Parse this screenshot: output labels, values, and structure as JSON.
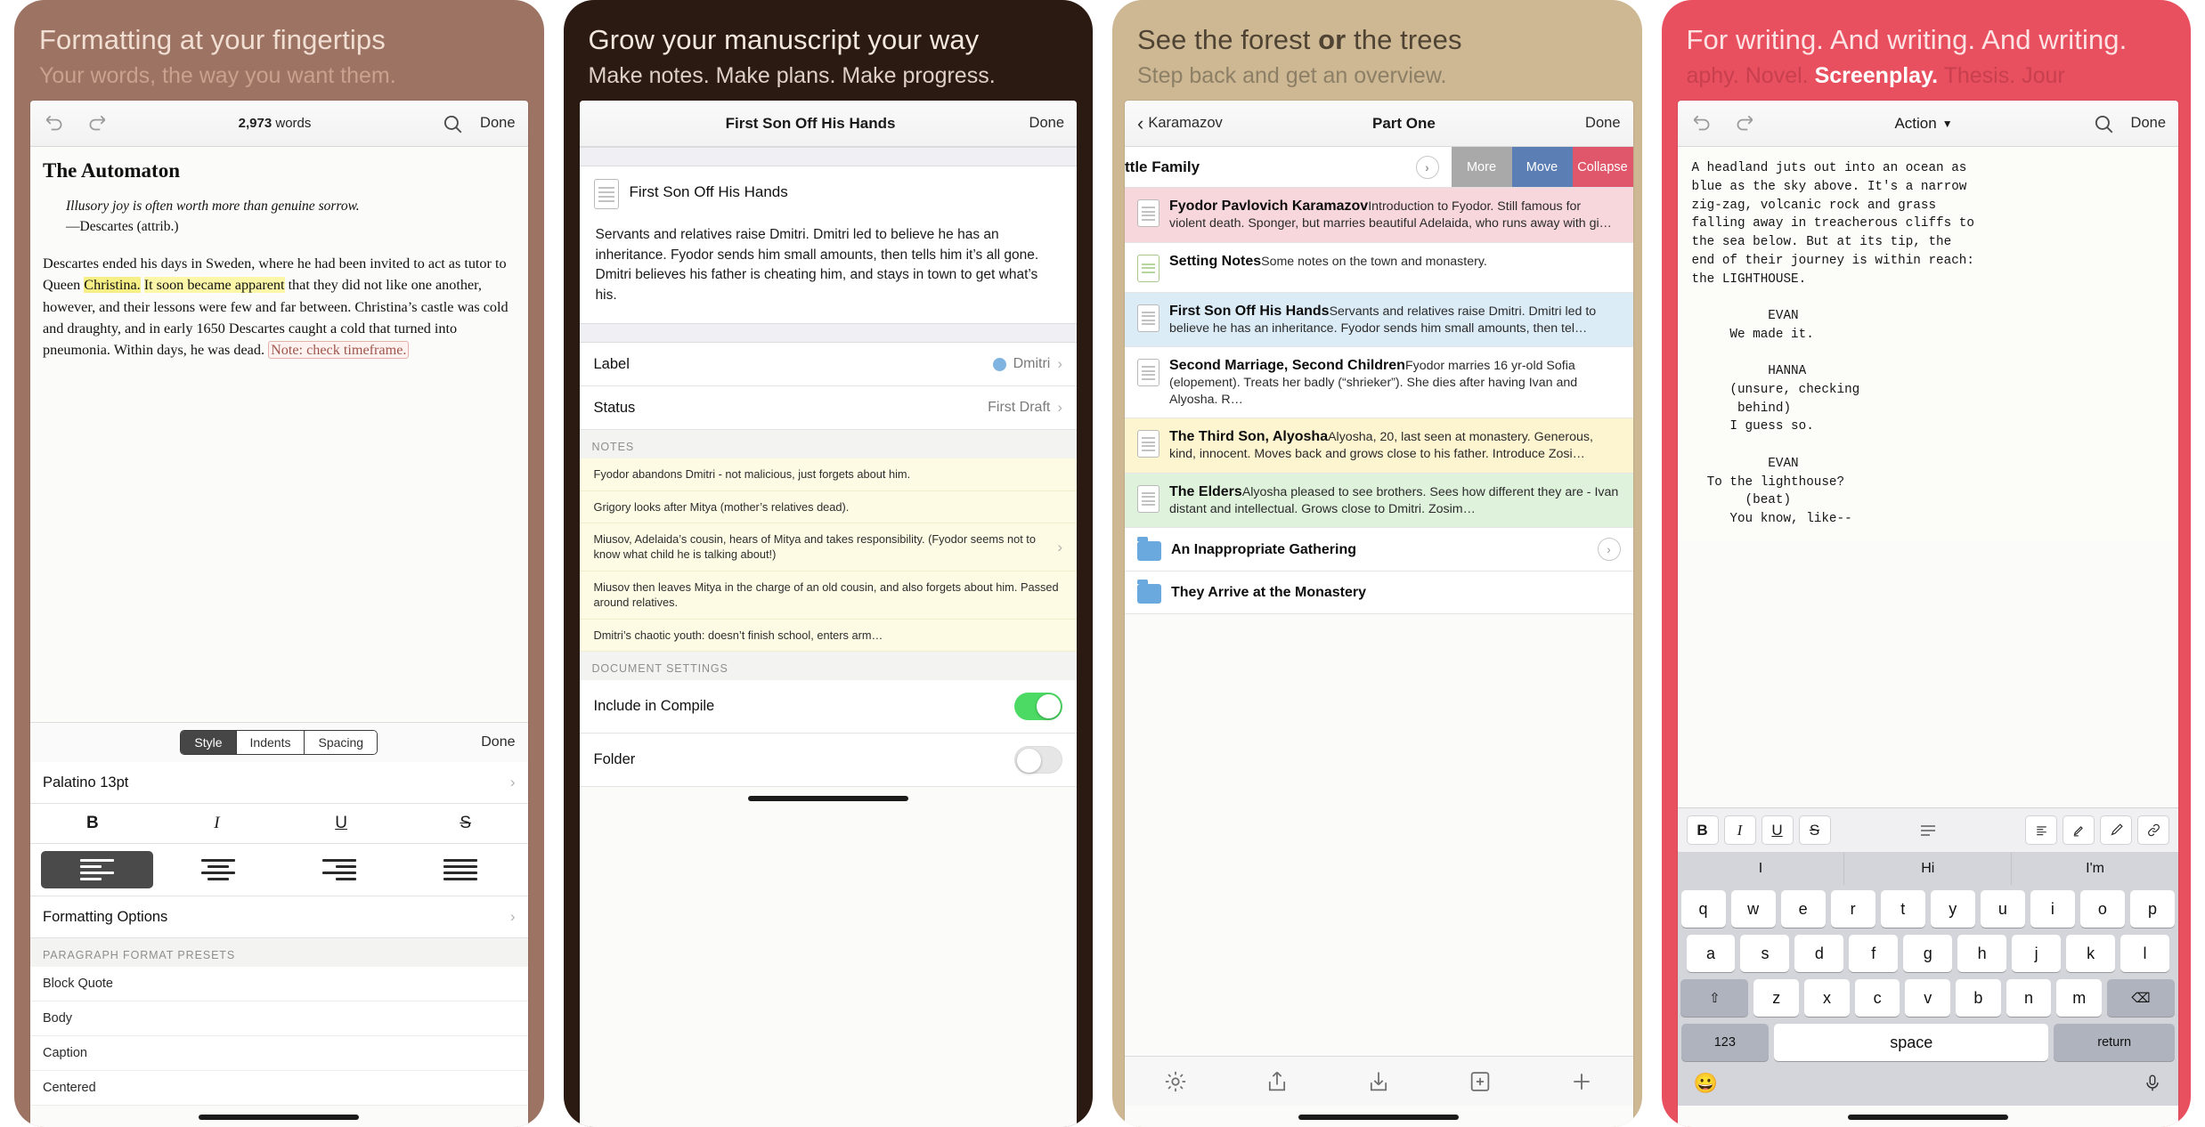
{
  "panels": [
    {
      "hero_title": "Formatting at your fingertips",
      "hero_sub": "Your words, the way you want them.",
      "nav": {
        "undo_icon": "undo-icon",
        "redo_icon": "redo-icon",
        "word_count": "2,973",
        "word_unit": "words",
        "search_icon": "search-icon",
        "done": "Done"
      },
      "doc": {
        "title": "The Automaton",
        "epigraph": "Illusory joy is often worth more than genuine sorrow.",
        "attrib": "—Descartes (attrib.)",
        "body_1": "Descartes ended his days in Sweden, where he had been invited to act as tutor to Queen ",
        "body_hl_a": "Christina.",
        "body_2": " ",
        "body_hl_b": "It soon became apparent",
        "body_3": " that they did not like one another, however, and their lessons were few and far between. Christina’s castle was cold and draughty, and in early 1650 Descartes caught a cold that turned into pneumonia. Within days, he was dead. ",
        "body_note": "Note: check timeframe."
      },
      "segments": [
        "Style",
        "Indents",
        "Spacing"
      ],
      "segment_active": "Style",
      "segment_done": "Done",
      "font_row": "Palatino 13pt",
      "format_buttons": [
        "B",
        "I",
        "U",
        "S"
      ],
      "format_options_row": "Formatting Options",
      "presets_header": "PARAGRAPH FORMAT PRESETS",
      "presets": [
        "Block Quote",
        "Body",
        "Caption",
        "Centered"
      ]
    },
    {
      "hero_title": "Grow your manuscript your way",
      "hero_sub": "Make notes. Make plans. Make progress.",
      "nav": {
        "title": "First Son Off His Hands",
        "done": "Done"
      },
      "doc_icon": "document-icon",
      "doc_title": "First Son Off His Hands",
      "synopsis": "Servants and relatives raise Dmitri. Dmitri led to believe he has an inheritance. Fyodor sends him small amounts, then tells him it’s all gone. Dmitri believes his father is cheating him, and stays in town to get what’s his.",
      "meta": [
        {
          "key": "Label",
          "value": "Dmitri",
          "swatch": "#7fb4e0"
        },
        {
          "key": "Status",
          "value": "First Draft",
          "swatch": ""
        }
      ],
      "notes_header": "NOTES",
      "notes": [
        "Fyodor abandons Dmitri - not malicious, just forgets about him.",
        "Grigory looks after Mitya (mother’s relatives dead).",
        "Miusov, Adelaida’s cousin, hears of Mitya and takes responsibility. (Fyodor seems not to know what child he is talking about!)",
        "Miusov then leaves Mitya in the charge of an old cousin, and also forgets about him. Passed around relatives.",
        "Dmitri’s chaotic youth: doesn’t finish school, enters arm…"
      ],
      "settings_header": "DOCUMENT SETTINGS",
      "settings": [
        {
          "key": "Include in Compile",
          "on": true
        },
        {
          "key": "Folder",
          "on": false
        }
      ]
    },
    {
      "hero_title_a": "See the forest ",
      "hero_title_b": "or",
      "hero_title_c": " the trees",
      "hero_sub": "Step back and get an overview.",
      "nav": {
        "back_icon": "chevron-left-icon",
        "back_label": "Karamazov",
        "title": "Part One",
        "done": "Done"
      },
      "swipe_row": {
        "label": "ttle Family",
        "more": "More",
        "move": "Move",
        "collapse": "Collapse"
      },
      "items": [
        {
          "icon": "document-icon",
          "title": "Fyodor Pavlovich  Karamazov",
          "sub": "Introduction to Fyodor. Still famous for violent death. Sponger, but marries beautiful Adelaida, who runs away with gi…",
          "tint": "r-pink"
        },
        {
          "icon": "note-icon",
          "title": "Setting Notes",
          "sub": "Some notes on the town and monastery.",
          "tint": "r-white"
        },
        {
          "icon": "document-icon",
          "title": "First Son Off His Hands",
          "sub": "Servants and relatives raise Dmitri. Dmitri led to believe he has an inheritance. Fyodor sends him small amounts, then tel…",
          "tint": "r-blue"
        },
        {
          "icon": "document-icon",
          "title": "Second Marriage, Second Children",
          "sub": "Fyodor marries 16 yr-old Sofia (elopement). Treats her badly (“shrieker”). She dies after having Ivan and Alyosha. R…",
          "tint": "r-white"
        },
        {
          "icon": "document-icon",
          "title": "The Third Son, Alyosha",
          "sub": "Alyosha, 20, last seen at monastery. Generous, kind, innocent. Moves back and grows close to his father. Introduce Zosi…",
          "tint": "r-yellow"
        },
        {
          "icon": "document-icon",
          "title": "The Elders",
          "sub": "Alyosha pleased to see brothers. Sees how different they are - Ivan distant and intellectual. Grows close to Dmitri. Zosim…",
          "tint": "r-green"
        },
        {
          "icon": "folder-icon",
          "title": "An Inappropriate Gathering",
          "sub": "",
          "tint": "r-white"
        },
        {
          "icon": "folder-icon",
          "title": "They Arrive at the Monastery",
          "sub": "",
          "tint": "r-white"
        }
      ],
      "tabs": [
        "gear-icon",
        "share-icon",
        "download-icon",
        "new-document-icon",
        "plus-icon"
      ]
    },
    {
      "hero_title": "For writing. And writing. And writing.",
      "hero_sub_a": "aphy. Novel. ",
      "hero_sub_b": "Screenplay.",
      "hero_sub_c": " Thesis. Jour",
      "nav": {
        "undo_icon": "undo-icon",
        "redo_icon": "redo-icon",
        "style": "Action",
        "chevron": "chevron-down-icon",
        "search_icon": "search-icon",
        "done": "Done"
      },
      "script_lines": [
        "A headland juts out into an ocean as",
        "blue as the sky above. It's a narrow",
        "zig-zag, volcanic rock and grass",
        "falling away in treacherous cliffs to",
        "the sea below. But at its tip, the",
        "end of their journey is within reach:",
        "the LIGHTHOUSE.",
        "",
        "          EVAN",
        "     We made it.",
        "",
        "          HANNA",
        "     (unsure, checking",
        "      behind)",
        "     I guess so.",
        "",
        "          EVAN",
        "  To the lighthouse?",
        "       (beat)",
        "     You know, like--"
      ],
      "kb_toolbar_left": [
        "B",
        "I",
        "U",
        "S"
      ],
      "kb_toolbar_center": "list-icon",
      "kb_toolbar_right": [
        "align-icon",
        "highlighter-icon",
        "pen-icon",
        "link-icon"
      ],
      "suggestions": [
        "I",
        "Hi",
        "I'm"
      ],
      "keys_row1": [
        "q",
        "w",
        "e",
        "r",
        "t",
        "y",
        "u",
        "i",
        "o",
        "p"
      ],
      "keys_row2": [
        "a",
        "s",
        "d",
        "f",
        "g",
        "h",
        "j",
        "k",
        "l"
      ],
      "keys_row3": [
        "z",
        "x",
        "c",
        "v",
        "b",
        "n",
        "m"
      ],
      "shift_icon": "shift-icon",
      "backspace_icon": "backspace-icon",
      "num_key": "123",
      "space_key": "space",
      "return_key": "return",
      "emoji_icon": "emoji-icon",
      "mic_icon": "microphone-icon"
    }
  ]
}
